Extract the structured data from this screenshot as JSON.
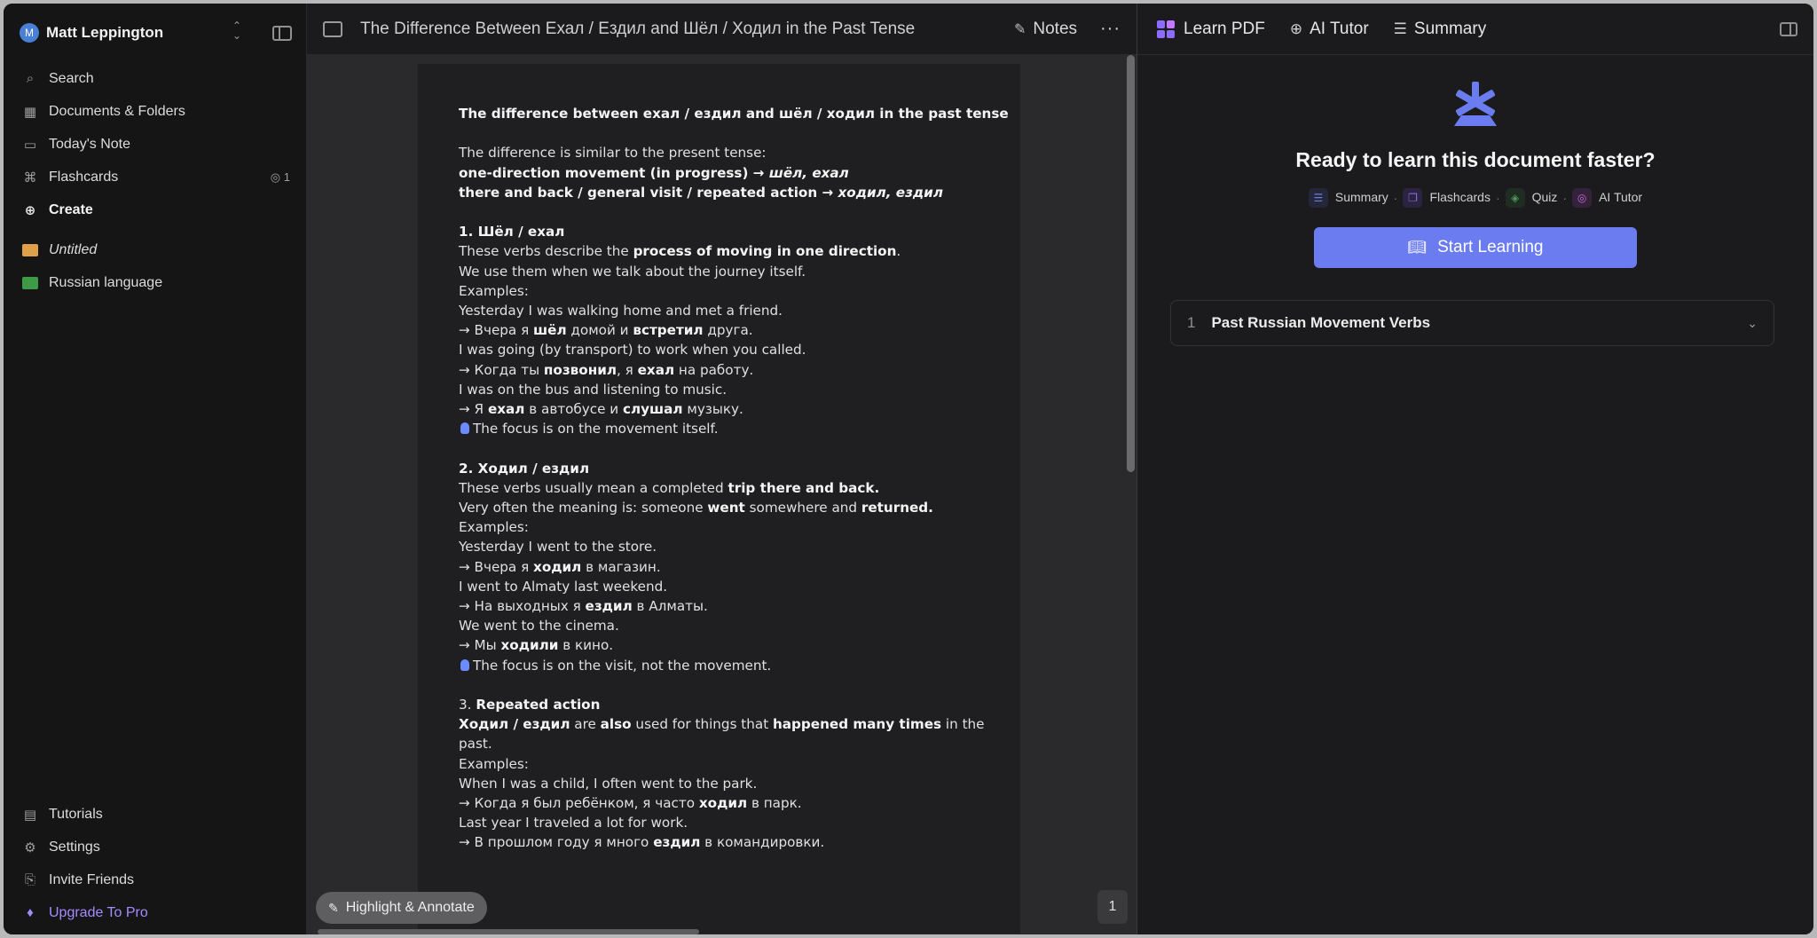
{
  "sidebar": {
    "user": {
      "initial": "M",
      "name": "Matt Leppington"
    },
    "nav": [
      {
        "icon": "search-icon",
        "glyph": "⌕",
        "label": "Search"
      },
      {
        "icon": "grid-icon",
        "glyph": "▦",
        "label": "Documents & Folders"
      },
      {
        "icon": "calendar-icon",
        "glyph": "▭",
        "label": "Today's Note"
      },
      {
        "icon": "flashcards-icon",
        "glyph": "⌘",
        "label": "Flashcards",
        "count": "1"
      },
      {
        "icon": "plus-circle-icon",
        "glyph": "⊕",
        "label": "Create"
      }
    ],
    "folders": [
      {
        "label": "Untitled",
        "color": "#e0a04a"
      },
      {
        "label": "Russian language",
        "color": "#3f9a48"
      }
    ],
    "bottom": [
      {
        "glyph": "▤",
        "label": "Tutorials"
      },
      {
        "glyph": "⚙",
        "label": "Settings"
      },
      {
        "glyph": "⎘",
        "label": "Invite Friends"
      },
      {
        "glyph": "♦",
        "label": "Upgrade To Pro"
      }
    ]
  },
  "center": {
    "title": "The Difference Between Ехал / Ездил and Шёл / Ходил in the Past Tense",
    "notes_label": "Notes",
    "more_label": "···",
    "highlight_label": "Highlight & Annotate",
    "page_number": "1"
  },
  "doc": {
    "heading": "The difference between ехал / ездил and шёл / ходил in the past tense",
    "intro": "The difference is similar to the present tense:",
    "rule1_a": "one-direction movement (in progress) → ",
    "rule1_b": "шёл, ехал",
    "rule2_a": "there and back / general visit / repeated action → ",
    "rule2_b": "ходил, ездил",
    "s1_title": "1. Шёл / ехал",
    "s1_l1_a": "These verbs describe the ",
    "s1_l1_b": "process of moving in one direction",
    "s1_l1_c": ".",
    "s1_l2": "We use them when we talk about the journey itself.",
    "examples": "Examples:",
    "s1_e1": "Yesterday I was walking home and met a friend.",
    "s1_e1r_a": " → Вчера я ",
    "s1_e1r_b": "шёл",
    "s1_e1r_c": " домой и ",
    "s1_e1r_d": "встретил",
    "s1_e1r_e": " друга.",
    "s1_e2": "I was going (by transport) to work when you called.",
    "s1_e2r_a": " → Когда ты ",
    "s1_e2r_b": "позвонил",
    "s1_e2r_c": ", я ",
    "s1_e2r_d": "ехал",
    "s1_e2r_e": " на работу.",
    "s1_e3": "I was on the bus and listening to music.",
    "s1_e3r_a": " → Я ",
    "s1_e3r_b": "ехал",
    "s1_e3r_c": " в автобусе и ",
    "s1_e3r_d": "слушал",
    "s1_e3r_e": " музыку.",
    "s1_focus": "The focus is on the movement itself.",
    "s2_title": "2. Ходил / ездил",
    "s2_l1_a": "These verbs usually mean a completed ",
    "s2_l1_b": "trip there and back.",
    "s2_l2_a": "Very often the meaning is: someone ",
    "s2_l2_b": "went",
    "s2_l2_c": " somewhere and ",
    "s2_l2_d": "returned.",
    "s2_e1": "Yesterday I went to the store.",
    "s2_e1r_a": " → Вчера я ",
    "s2_e1r_b": "ходил",
    "s2_e1r_c": " в магазин.",
    "s2_e2": "I went to Almaty last weekend.",
    "s2_e2r_a": " → На выходных я ",
    "s2_e2r_b": "ездил",
    "s2_e2r_c": " в Алматы.",
    "s2_e3": "We went to the cinema.",
    "s2_e3r_a": " → Мы ",
    "s2_e3r_b": "ходили",
    "s2_e3r_c": " в кино.",
    "s2_focus": "The focus is on the visit, not the movement.",
    "s3_num": "3. ",
    "s3_title": "Repeated action",
    "s3_l1_a": "Ходил / ездил",
    "s3_l1_b": " are ",
    "s3_l1_c": "also",
    "s3_l1_d": " used for things that ",
    "s3_l1_e": "happened many times",
    "s3_l1_f": " in the",
    "s3_l1_g": "past.",
    "s3_e1": "When I was a child, I often went to the park.",
    "s3_e1r_a": " → Когда я был ребёнком, я часто ",
    "s3_e1r_b": "ходил",
    "s3_e1r_c": " в парк.",
    "s3_e2": "Last year I traveled a lot for work.",
    "s3_e2r_a": " → В прошлом году я много ",
    "s3_e2r_b": "ездил",
    "s3_e2r_c": " в командировки."
  },
  "right": {
    "tabs": [
      {
        "label": "Learn PDF"
      },
      {
        "label": "AI Tutor"
      },
      {
        "label": "Summary"
      }
    ],
    "hero_title": "Ready to learn this document faster?",
    "features": [
      {
        "label": "Summary",
        "color": "#6f7bd6",
        "bg": "#24263a"
      },
      {
        "label": "Flashcards",
        "color": "#8a6df2",
        "bg": "#2a2440"
      },
      {
        "label": "Quiz",
        "color": "#4f9a5a",
        "bg": "#1f2c22"
      },
      {
        "label": "AI Tutor",
        "color": "#c56ad8",
        "bg": "#33223a"
      }
    ],
    "start_label": "Start Learning",
    "chapter": {
      "number": "1",
      "title": "Past Russian Movement Verbs"
    },
    "accent": "#6a7cf0"
  }
}
